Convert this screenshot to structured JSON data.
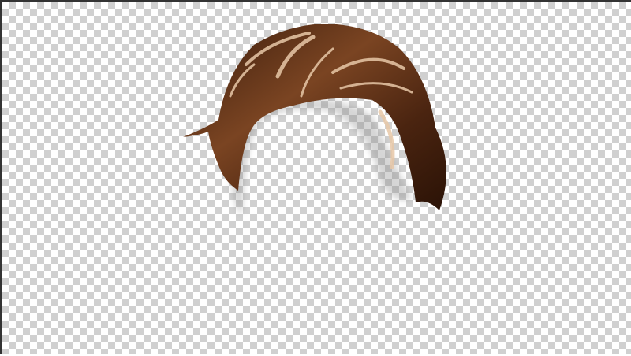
{
  "image": {
    "subject": "hair-cutout",
    "background": "transparency-checkerboard",
    "colors": {
      "hair_dark": "#2a1408",
      "hair_mid": "#6b3a1c",
      "hair_highlight": "#e8c8a8",
      "checker_light": "#ffffff",
      "checker_dark": "#d0d0d0"
    }
  }
}
